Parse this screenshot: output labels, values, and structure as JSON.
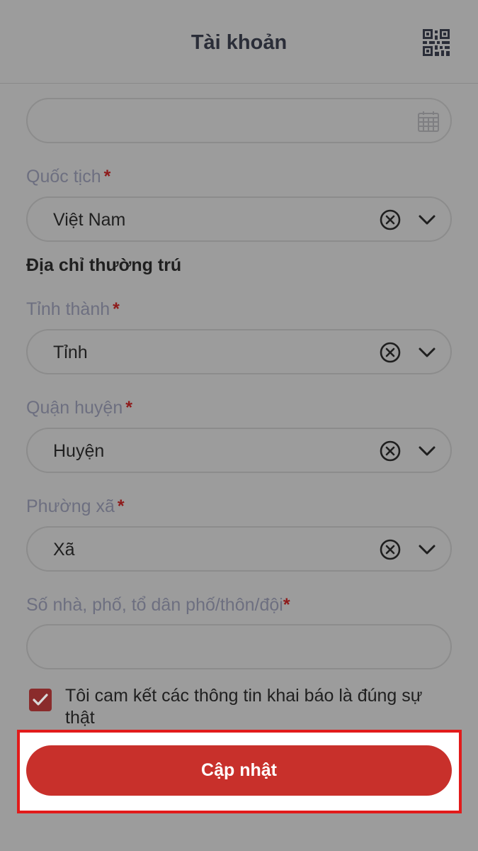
{
  "header": {
    "title": "Tài khoản"
  },
  "fields": {
    "nationality": {
      "label": "Quốc tịch",
      "required_mark": "*",
      "value": "Việt Nam"
    },
    "province": {
      "label": "Tỉnh thành",
      "required_mark": "*",
      "value": "Tỉnh"
    },
    "district": {
      "label": "Quận huyện",
      "required_mark": "*",
      "value": "Huyện"
    },
    "ward": {
      "label": "Phường xã",
      "required_mark": "*",
      "value": "Xã"
    },
    "street": {
      "label": "Số nhà, phố, tổ dân phố/thôn/đội",
      "required_mark": "*",
      "value": ""
    }
  },
  "section": {
    "permanent_address": "Địa chỉ thường trú"
  },
  "commitment": {
    "text": "Tôi cam kết các thông tin khai báo là đúng sự thật",
    "checked": true
  },
  "actions": {
    "update_label": "Cập nhật"
  },
  "icons": {
    "qr": "qr-code-icon",
    "calendar": "calendar-icon",
    "clear": "clear-circle-icon",
    "dropdown": "chevron-down-icon",
    "check": "checkmark-icon"
  },
  "colors": {
    "primary": "#c8302b",
    "required": "#8e1b1b",
    "highlight": "#e21b1b"
  }
}
